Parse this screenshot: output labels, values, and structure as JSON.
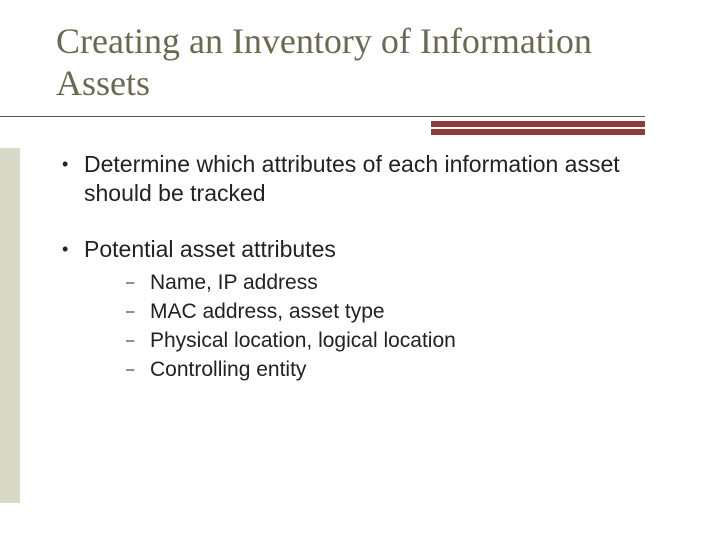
{
  "title": "Creating an Inventory of Information Assets",
  "bullets": [
    {
      "text": "Determine which attributes of each information asset should be tracked",
      "sub": []
    },
    {
      "text": "Potential asset attributes",
      "sub": [
        "Name, IP address",
        "MAC address, asset type",
        "Physical location, logical location",
        "Controlling entity"
      ]
    }
  ],
  "colors": {
    "title": "#6b6952",
    "accent": "#8c3b36",
    "gutter": "#d9d9c8"
  }
}
